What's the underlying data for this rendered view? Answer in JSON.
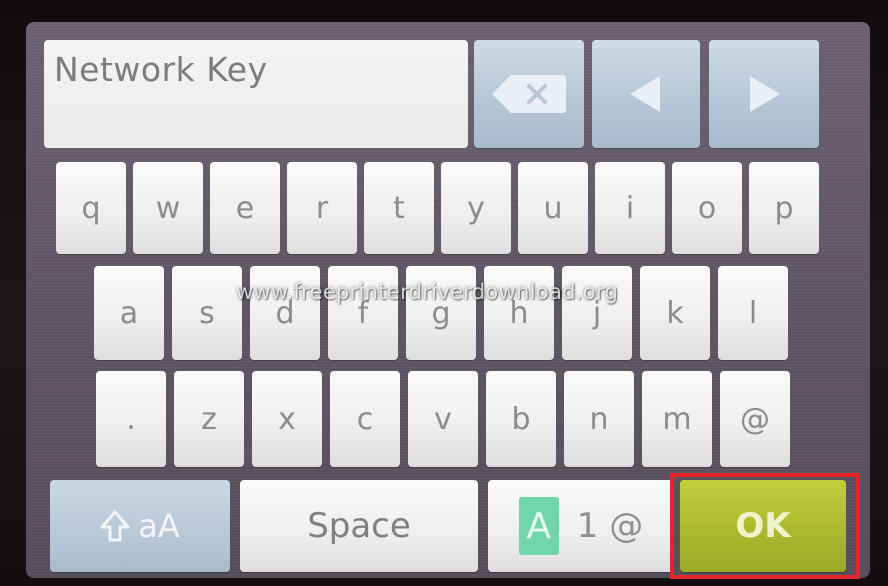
{
  "input": {
    "label": "Network Key"
  },
  "nav": {
    "backspace_icon": "backspace-icon",
    "left_icon": "arrow-left-icon",
    "right_icon": "arrow-right-icon"
  },
  "keyboard": {
    "row1": [
      "q",
      "w",
      "e",
      "r",
      "t",
      "y",
      "u",
      "i",
      "o",
      "p"
    ],
    "row2": [
      "a",
      "s",
      "d",
      "f",
      "g",
      "h",
      "j",
      "k",
      "l"
    ],
    "row3": [
      ".",
      "z",
      "x",
      "c",
      "v",
      "b",
      "n",
      "m",
      "@"
    ]
  },
  "bottom": {
    "shift_label": "aA",
    "shift_icon": "shift-arrow-icon",
    "space_label": "Space",
    "mode_a": "A",
    "mode_rest": "1 @",
    "ok_label": "OK"
  },
  "watermark": "www.freeprinterdriverdownload.org",
  "colors": {
    "ok_button": "#a9b92c",
    "nav_keys": "#b4c6d6",
    "mode_indicator": "#6fd6a8",
    "highlight": "#e5252a",
    "screen_background": "#5e5564"
  }
}
